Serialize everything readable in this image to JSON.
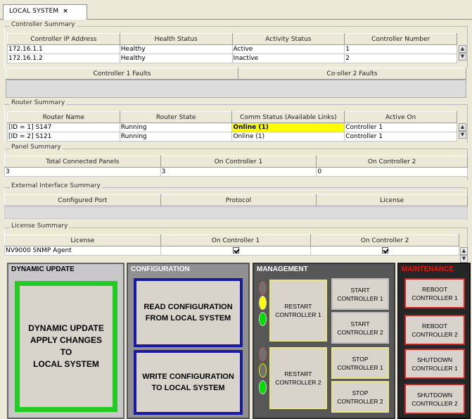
{
  "tab": {
    "label": "LOCAL SYSTEM",
    "close": "×"
  },
  "controller_summary": {
    "title": "Controller Summary",
    "columns": [
      "Controller IP Address",
      "Health Status",
      "Activity Status",
      "Controller Number"
    ],
    "rows": [
      [
        "172.16.1.1",
        "Healthy",
        "Active",
        "1"
      ],
      [
        "172.16.1.2",
        "Healthy",
        "Inactive",
        "2"
      ]
    ]
  },
  "faults": {
    "c1": "Controller 1 Faults",
    "c2": "Co·oller 2 Faults"
  },
  "router_summary": {
    "title": "Router Summary",
    "columns": [
      "Router Name",
      "Router State",
      "Comm Status (Available Links)",
      "Active On"
    ],
    "rows": [
      [
        "[ID = 1] S147",
        "Running",
        "Online (1)",
        "Controller 1"
      ],
      [
        "[ID = 2] S121",
        "Running",
        "Online (1)",
        "Controller 1"
      ]
    ]
  },
  "panel_summary": {
    "title": "Panel Summary",
    "columns": [
      "Total Connected Panels",
      "On Controller 1",
      "On Controller 2"
    ],
    "row": [
      "3",
      "3",
      "0"
    ]
  },
  "external_summary": {
    "title": "External Interface Summary",
    "columns": [
      "Configured Port",
      "Protocol",
      "License"
    ]
  },
  "license_summary": {
    "title": "License Summary",
    "columns": [
      "License",
      "On Controller 1",
      "On Controller 2"
    ],
    "row": {
      "license": "NV9000 SNMP Agent",
      "c1_checked": true,
      "c2_checked": true
    }
  },
  "dynamic_update": {
    "title": "DYNAMIC UPDATE",
    "button": "DYNAMIC UPDATE APPLY CHANGES TO LOCAL SYSTEM",
    "lines": [
      "DYNAMIC UPDATE",
      "APPLY CHANGES",
      "TO",
      "LOCAL SYSTEM"
    ]
  },
  "configuration": {
    "title": "CONFIGURATION",
    "read_lines": [
      "READ CONFIGURATION",
      "FROM LOCAL SYSTEM"
    ],
    "write_lines": [
      "WRITE CONFIGURATION",
      "TO LOCAL SYSTEM"
    ]
  },
  "management": {
    "title": "MANAGEMENT",
    "restart1_lines": [
      "RESTART",
      "CONTROLLER 1"
    ],
    "restart2_lines": [
      "RESTART",
      "CONTROLLER 2"
    ],
    "start1_lines": [
      "START",
      "CONTROLLER 1"
    ],
    "start2_lines": [
      "START",
      "CONTROLLER 2"
    ],
    "stop1_lines": [
      "STOP",
      "CONTROLLER 1"
    ],
    "stop2_lines": [
      "STOP",
      "CONTROLLER 2"
    ]
  },
  "maintenance": {
    "title": "MAINTENANCE",
    "reboot1_lines": [
      "REBOOT",
      "CONTROLLER 1"
    ],
    "reboot2_lines": [
      "REBOOT",
      "CONTROLLER 2"
    ],
    "shutdown1_lines": [
      "SHUTDOWN",
      "CONTROLLER 1"
    ],
    "shutdown2_lines": [
      "SHUTDOWN",
      "CONTROLLER 2"
    ]
  },
  "colors": {
    "highlight": "#ffff00",
    "dynamic_border": "#22cc22",
    "config_border": "#1a1aa0",
    "mgmt_border": "#e0e070",
    "maint_border": "#cc2222",
    "maint_title": "#ee1111"
  },
  "icons": {
    "scroll_up": "▲",
    "scroll_down": "▼"
  }
}
